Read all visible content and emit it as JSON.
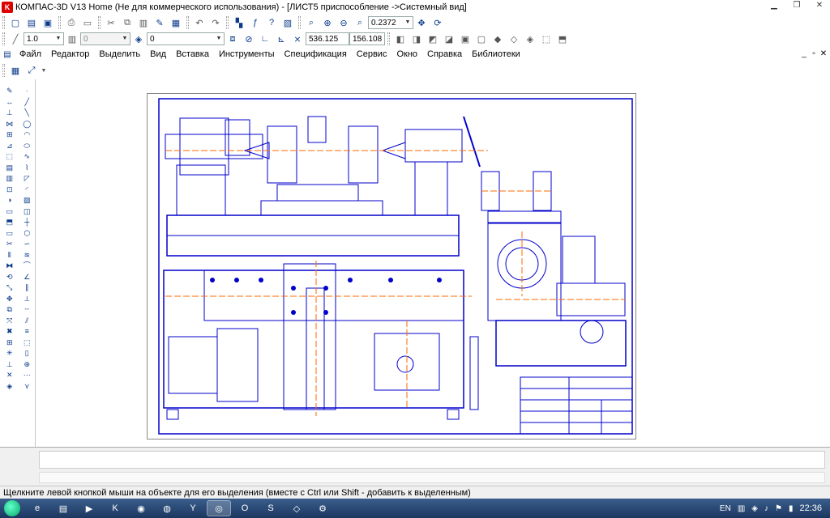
{
  "window": {
    "title": "КОМПАС-3D V13 Home (Не для коммерческого использования) - [ЛИСТ5 приспособление ->Системный вид]"
  },
  "toolbar1": {
    "zoom_value": "0.2372"
  },
  "toolbar2": {
    "line_width": "1.0",
    "layer_value": "0",
    "style_value": "0",
    "coord_x": "536.125",
    "coord_y": "156.108"
  },
  "menu": {
    "items": [
      "Файл",
      "Редактор",
      "Выделить",
      "Вид",
      "Вставка",
      "Инструменты",
      "Спецификация",
      "Сервис",
      "Окно",
      "Справка",
      "Библиотеки"
    ]
  },
  "statusbar": {
    "hint": "Щелкните левой кнопкой мыши на объекте для его выделения (вместе с Ctrl или Shift - добавить к выделенным)"
  },
  "taskbar": {
    "language": "EN",
    "time": "22:36"
  },
  "colors": {
    "drawing_line": "#0000cc",
    "axis_line": "#ff6a00",
    "canvas_bg": "#ffffff"
  },
  "icons": {
    "app": "kompas-logo-icon",
    "new": "new-file-icon",
    "open": "open-folder-icon",
    "save": "save-icon",
    "print": "print-icon",
    "zoom": "zoom-icon"
  }
}
